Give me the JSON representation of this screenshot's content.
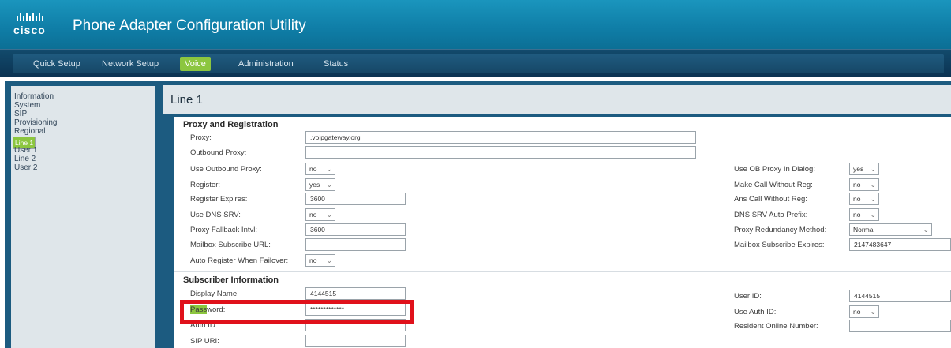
{
  "header": {
    "logo_text": "cisco",
    "title": "Phone Adapter Configuration Utility"
  },
  "nav": {
    "tabs": [
      {
        "label": "Quick Setup"
      },
      {
        "label": "Network Setup"
      },
      {
        "label": "Voice",
        "active": true
      },
      {
        "label": "Administration"
      },
      {
        "label": "Status"
      }
    ],
    "active_color": "#8cc63f"
  },
  "sidebar": {
    "items": [
      {
        "label": "Information"
      },
      {
        "label": "System"
      },
      {
        "label": "SIP"
      },
      {
        "label": "Provisioning"
      },
      {
        "label": "Regional"
      },
      {
        "label": "Line 1",
        "selected": true
      },
      {
        "label": "User 1"
      },
      {
        "label": "Line 2"
      },
      {
        "label": "User 2"
      }
    ]
  },
  "page": {
    "title": "Line 1"
  },
  "proxy_section": {
    "title": "Proxy and Registration",
    "left": [
      {
        "label": "Proxy:",
        "value": ".voipgateway.org"
      },
      {
        "label": "Outbound Proxy:",
        "value": ""
      },
      {
        "label": "Use Outbound Proxy:",
        "value": "no"
      },
      {
        "label": "Register:",
        "value": "yes"
      },
      {
        "label": "Register Expires:",
        "value": "3600"
      },
      {
        "label": "Use DNS SRV:",
        "value": "no"
      },
      {
        "label": "Proxy Fallback Intvl:",
        "value": "3600"
      },
      {
        "label": "Mailbox Subscribe URL:",
        "value": ""
      },
      {
        "label": "Auto Register When Failover:",
        "value": "no"
      }
    ],
    "right": [
      {
        "label": "Use OB Proxy In Dialog:",
        "value": "yes"
      },
      {
        "label": "Make Call Without Reg:",
        "value": "no"
      },
      {
        "label": "Ans Call Without Reg:",
        "value": "no"
      },
      {
        "label": "DNS SRV Auto Prefix:",
        "value": "no"
      },
      {
        "label": "Proxy Redundancy Method:",
        "value": "Normal"
      },
      {
        "label": "Mailbox Subscribe Expires:",
        "value": "2147483647"
      }
    ]
  },
  "subscriber_section": {
    "title": "Subscriber Information",
    "left": [
      {
        "label": "Display Name:",
        "value": "4144515"
      },
      {
        "label_highlight": "Pass",
        "label_rest": "word:",
        "value": "*************"
      },
      {
        "label": "Auth ID:",
        "value": ""
      },
      {
        "label": "SIP URI:",
        "value": ""
      }
    ],
    "right": [
      {
        "label": "User ID:",
        "value": "4144515"
      },
      {
        "label": "Use Auth ID:",
        "value": "no"
      },
      {
        "label": "Resident Online Number:",
        "value": ""
      }
    ]
  },
  "icons": {
    "dropdown": "chevron-down-icon",
    "logo": "cisco-logo-icon"
  },
  "colors": {
    "highlight_box": "#e0111b",
    "header": "#1a95bd"
  }
}
